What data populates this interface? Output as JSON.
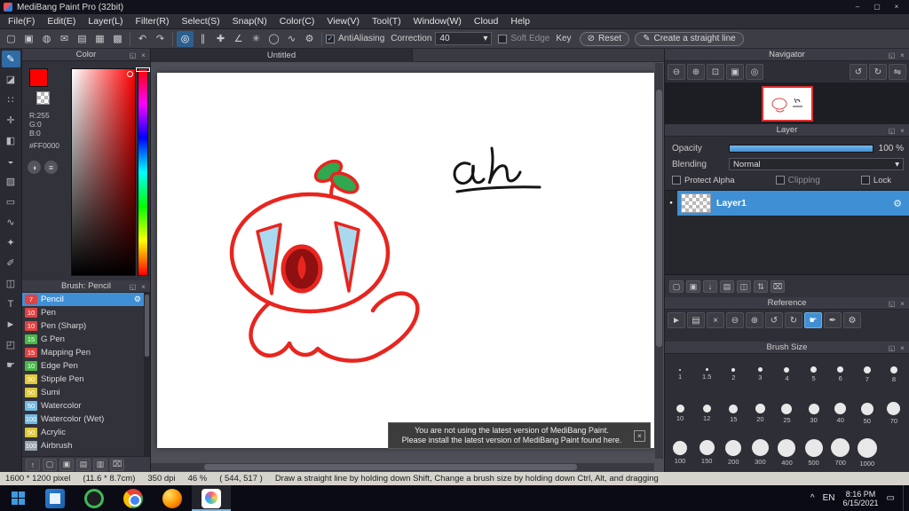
{
  "icons": {
    "close": "×",
    "popout": "◱",
    "min": "–",
    "max": "▢",
    "dropdown": "▾",
    "check": "✓",
    "undo": "↶",
    "redo": "↷",
    "gear": "⚙",
    "circle_slash": "⊘",
    "pencil": "✎",
    "tray_arrow": "^",
    "action_center": "▭",
    "eye_dot": "●",
    "color_wheel": "◑",
    "color_sliders": "≡"
  },
  "titlebar": {
    "title": "MediBang Paint Pro (32bit)"
  },
  "menubar": {
    "items": [
      "File(F)",
      "Edit(E)",
      "Layer(L)",
      "Filter(R)",
      "Select(S)",
      "Snap(N)",
      "Color(C)",
      "View(V)",
      "Tool(T)",
      "Window(W)",
      "Cloud",
      "Help"
    ]
  },
  "toolbar": {
    "file_icons": [
      {
        "name": "new-canvas-icon",
        "glyph": "▢"
      },
      {
        "name": "save-icon",
        "glyph": "▣"
      },
      {
        "name": "publish-icon",
        "glyph": "◍"
      },
      {
        "name": "comment-icon",
        "glyph": "✉"
      },
      {
        "name": "page-list-icon",
        "glyph": "▤"
      },
      {
        "name": "grid-view-icon",
        "glyph": "▦"
      },
      {
        "name": "panel-layout-icon",
        "glyph": "▩"
      }
    ],
    "snap_icons": [
      {
        "name": "snap-off-icon",
        "glyph": "◎",
        "active": true
      },
      {
        "name": "snap-parallel-icon",
        "glyph": "∥"
      },
      {
        "name": "snap-cross-icon",
        "glyph": "✚"
      },
      {
        "name": "snap-vanishing-icon",
        "glyph": "∠"
      },
      {
        "name": "snap-radial-icon",
        "glyph": "✳"
      },
      {
        "name": "snap-ellipse-icon",
        "glyph": "◯"
      },
      {
        "name": "snap-curve-icon",
        "glyph": "∿"
      },
      {
        "name": "snap-settings-icon",
        "glyph": "⚙"
      }
    ],
    "antialiasing_label": "AntiAliasing",
    "correction_label": "Correction",
    "correction_value": "40",
    "soft_edge_label": "Soft Edge",
    "key_label": "Key",
    "reset_label": "Reset",
    "straight_line_label": "Create a straight line"
  },
  "tool_strip": {
    "tools": [
      {
        "name": "brush-tool-icon",
        "glyph": "✎",
        "active": true
      },
      {
        "name": "eraser-tool-icon",
        "glyph": "◪"
      },
      {
        "name": "dot-tool-icon",
        "glyph": "∷"
      },
      {
        "name": "move-tool-icon",
        "glyph": "✛"
      },
      {
        "name": "fill-tool-icon",
        "glyph": "◧"
      },
      {
        "name": "bucket-tool-icon",
        "glyph": "◒"
      },
      {
        "name": "gradient-tool-icon",
        "glyph": "▨"
      },
      {
        "name": "select-tool-icon",
        "glyph": "▭"
      },
      {
        "name": "lasso-tool-icon",
        "glyph": "∿"
      },
      {
        "name": "magic-wand-tool-icon",
        "glyph": "✦"
      },
      {
        "name": "select-pen-tool-icon",
        "glyph": "✐"
      },
      {
        "name": "select-eraser-tool-icon",
        "glyph": "◫"
      },
      {
        "name": "text-tool-icon",
        "glyph": "T"
      },
      {
        "name": "operation-tool-icon",
        "glyph": "►"
      },
      {
        "name": "divide-tool-icon",
        "glyph": "◰"
      },
      {
        "name": "hand-tool-icon",
        "glyph": "☛"
      }
    ]
  },
  "color_panel": {
    "title": "Color",
    "r_label": "R:255",
    "g_label": "G:0",
    "b_label": "B:0",
    "hex": "#FF0000",
    "selected_color": "#ff0000"
  },
  "brush_panel": {
    "title": "Brush: Pencil",
    "brushes": [
      {
        "size": "7",
        "name": "Pencil",
        "chip": "#e04343",
        "selected": true
      },
      {
        "size": "10",
        "name": "Pen",
        "chip": "#e04343"
      },
      {
        "size": "10",
        "name": "Pen (Sharp)",
        "chip": "#e04343"
      },
      {
        "size": "15",
        "name": "G Pen",
        "chip": "#4cb64c"
      },
      {
        "size": "15",
        "name": "Mapping Pen",
        "chip": "#e04343"
      },
      {
        "size": "10",
        "name": "Edge Pen",
        "chip": "#4cb64c"
      },
      {
        "size": "50",
        "name": "Stipple Pen",
        "chip": "#e0c838"
      },
      {
        "size": "50",
        "name": "Sumi",
        "chip": "#e0c838"
      },
      {
        "size": "50",
        "name": "Watercolor",
        "chip": "#74b9e0"
      },
      {
        "size": "100",
        "name": "Watercolor (Wet)",
        "chip": "#74b9e0"
      },
      {
        "size": "50",
        "name": "Acrylic",
        "chip": "#e0c838"
      },
      {
        "size": "100",
        "name": "Airbrush",
        "chip": "#9aa4ae"
      }
    ],
    "footer_icons": [
      {
        "name": "previous-brush-icon",
        "glyph": "↑"
      },
      {
        "name": "add-brush-icon",
        "glyph": "▢"
      },
      {
        "name": "duplicate-brush-icon",
        "glyph": "▣"
      },
      {
        "name": "brush-folder-icon",
        "glyph": "▤"
      },
      {
        "name": "brush-menu-icon",
        "glyph": "▥"
      },
      {
        "name": "delete-brush-icon",
        "glyph": "⌧"
      }
    ]
  },
  "canvas": {
    "tab_title": "Untitled",
    "handwriting": "ah"
  },
  "navigator": {
    "title": "Navigator",
    "icons_left": [
      {
        "name": "zoom-out-icon",
        "glyph": "⊖"
      },
      {
        "name": "zoom-in-icon",
        "glyph": "⊕"
      },
      {
        "name": "fit-window-icon",
        "glyph": "⊡"
      },
      {
        "name": "actual-pixels-icon",
        "glyph": "▣"
      },
      {
        "name": "reset-view-icon",
        "glyph": "◎"
      }
    ],
    "icons_right": [
      {
        "name": "rotate-left-icon",
        "glyph": "↺"
      },
      {
        "name": "rotate-right-icon",
        "glyph": "↻"
      },
      {
        "name": "flip-horizontal-icon",
        "glyph": "⇋"
      }
    ]
  },
  "layer_panel": {
    "title": "Layer",
    "opacity_label": "Opacity",
    "opacity_value": "100 %",
    "blending_label": "Blending",
    "blending_value": "Normal",
    "protect_alpha_label": "Protect Alpha",
    "clipping_label": "Clipping",
    "lock_label": "Lock",
    "layers": [
      {
        "name": "Layer1",
        "selected": true
      }
    ],
    "footer_icons": [
      {
        "name": "add-layer-icon",
        "glyph": "▢"
      },
      {
        "name": "duplicate-layer-icon",
        "glyph": "▣"
      },
      {
        "name": "merge-down-icon",
        "glyph": "↓"
      },
      {
        "name": "add-folder-icon",
        "glyph": "▤"
      },
      {
        "name": "layer-mask-icon",
        "glyph": "◫"
      },
      {
        "name": "reorder-layer-icon",
        "glyph": "⇅"
      },
      {
        "name": "delete-layer-icon",
        "glyph": "⌧"
      }
    ]
  },
  "reference_panel": {
    "title": "Reference",
    "icons": [
      {
        "name": "pointer-icon",
        "glyph": "►"
      },
      {
        "name": "open-reference-icon",
        "glyph": "▤"
      },
      {
        "name": "clear-reference-icon",
        "glyph": "×"
      },
      {
        "name": "ref-zoom-out-icon",
        "glyph": "⊖"
      },
      {
        "name": "ref-zoom-in-icon",
        "glyph": "⊕"
      },
      {
        "name": "ref-rotate-left-icon",
        "glyph": "↺"
      },
      {
        "name": "ref-rotate-right-icon",
        "glyph": "↻"
      },
      {
        "name": "ref-hand-icon",
        "glyph": "☛",
        "active": true
      },
      {
        "name": "ref-eyedropper-icon",
        "glyph": "✒"
      },
      {
        "name": "ref-settings-icon",
        "glyph": "⚙"
      }
    ]
  },
  "brush_size_panel": {
    "title": "Brush Size",
    "sizes": [
      "1",
      "1.5",
      "2",
      "3",
      "4",
      "5",
      "6",
      "7",
      "8",
      "10",
      "12",
      "15",
      "20",
      "25",
      "30",
      "40",
      "50",
      "70",
      "100",
      "150",
      "200",
      "300",
      "400",
      "500",
      "700",
      "1000"
    ]
  },
  "notification": {
    "line1": "You are not using the latest version of MediBang Paint.",
    "line2": "Please install the latest version of MediBang Paint found here.",
    "close": "×"
  },
  "statusbar": {
    "size": "1600 * 1200 pixel",
    "cm": "(11.6 * 8.7cm)",
    "dpi": "350 dpi",
    "zoom": "46 %",
    "coords": "( 544, 517 )",
    "hint": "Draw a straight line by holding down Shift, Change a brush size by holding down Ctrl, Alt, and dragging"
  },
  "taskbar": {
    "apps": [
      {
        "name": "photos-app-icon",
        "css": "app-photos"
      },
      {
        "name": "media-app-icon",
        "css": "app-media"
      },
      {
        "name": "chrome-app-icon",
        "css": "app-chrome"
      },
      {
        "name": "firefox-app-icon",
        "css": "app-firefox"
      },
      {
        "name": "medibang-app-icon",
        "css": "app-medibang",
        "active": true
      }
    ],
    "tray_language": "EN",
    "time": "8:16 PM",
    "date": "6/15/2021"
  }
}
